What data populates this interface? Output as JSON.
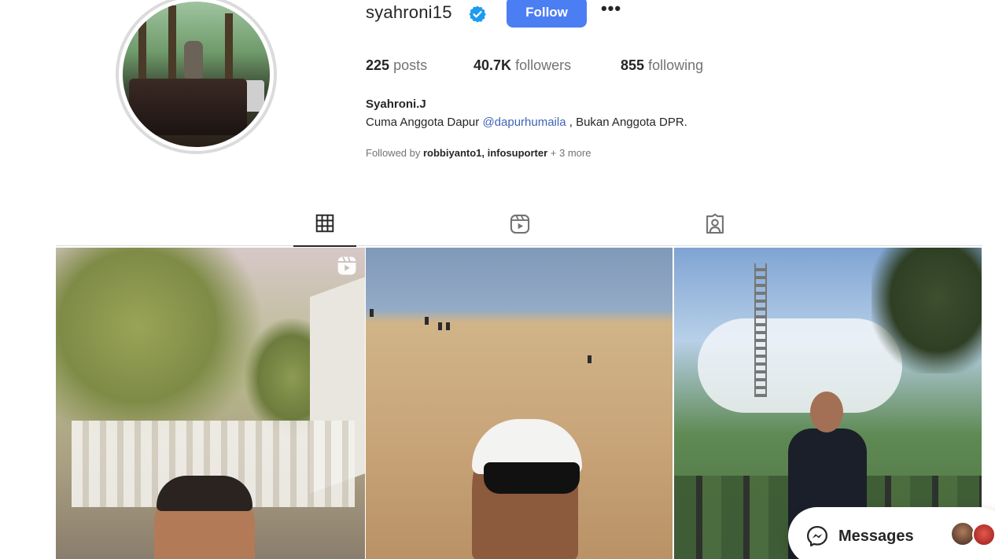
{
  "profile": {
    "username": "syahroni15",
    "verified": true,
    "follow_label": "Follow",
    "more_label": "•••",
    "stats": {
      "posts_count": "225",
      "posts_label": "posts",
      "followers_count": "40.7K",
      "followers_label": "followers",
      "following_count": "855",
      "following_label": "following"
    },
    "full_name": "Syahroni.J",
    "bio_prefix": "Cuma Anggota Dapur ",
    "bio_mention": "@dapurhumaila",
    "bio_suffix": " , Bukan Anggota DPR.",
    "followed_by_prefix": "Followed by ",
    "followed_by_users": "robbiyanto1, infosuporter",
    "followed_by_more": " + 3 more"
  },
  "tabs": [
    {
      "name": "posts",
      "icon": "grid-icon",
      "active": true
    },
    {
      "name": "reels",
      "icon": "reels-icon",
      "active": false
    },
    {
      "name": "tagged",
      "icon": "tagged-icon",
      "active": false
    }
  ],
  "posts": [
    {
      "type": "reel",
      "icon": "reels-icon"
    },
    {
      "type": "photo"
    },
    {
      "type": "photo"
    }
  ],
  "messages": {
    "label": "Messages",
    "icon": "messenger-icon"
  },
  "colors": {
    "follow_button": "#4c7ef3",
    "verified_badge": "#1d9bf0",
    "mention": "#3f63b8",
    "secondary_text": "#737373"
  }
}
